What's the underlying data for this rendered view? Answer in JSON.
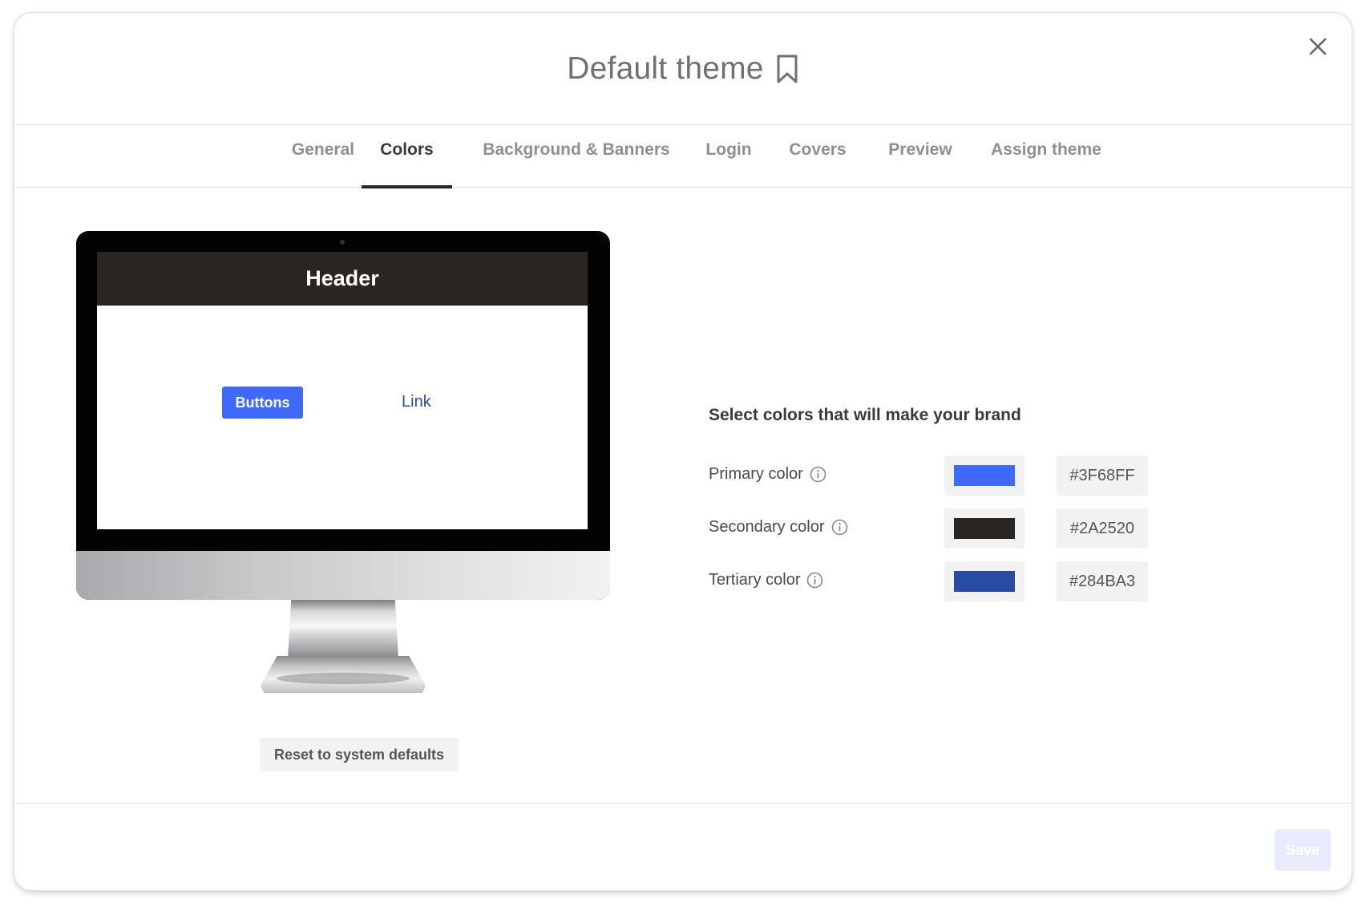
{
  "dialog": {
    "title": "Default theme",
    "close_icon": "close-icon",
    "bookmark_icon": "bookmark-icon"
  },
  "tabs": [
    {
      "label": "General",
      "active": false
    },
    {
      "label": "Colors",
      "active": true
    },
    {
      "label": "Background & Banners",
      "active": false
    },
    {
      "label": "Login",
      "active": false
    },
    {
      "label": "Covers",
      "active": false
    },
    {
      "label": "Preview",
      "active": false
    },
    {
      "label": "Assign theme",
      "active": false
    }
  ],
  "preview": {
    "header_label": "Header",
    "button_label": "Buttons",
    "link_label": "Link"
  },
  "reset_label": "Reset to system defaults",
  "colors_panel": {
    "heading": "Select colors that will make your brand",
    "rows": [
      {
        "label": "Primary color",
        "hex": "#3F68FF",
        "info_icon": "info-icon"
      },
      {
        "label": "Secondary color",
        "hex": "#2A2520",
        "info_icon": "info-icon"
      },
      {
        "label": "Tertiary color",
        "hex": "#284BA3",
        "info_icon": "info-icon"
      }
    ]
  },
  "footer": {
    "save_label": "Save",
    "save_disabled": true
  },
  "theme_colors": {
    "primary": "#3F68FF",
    "secondary": "#2A2520",
    "tertiary": "#284BA3"
  }
}
